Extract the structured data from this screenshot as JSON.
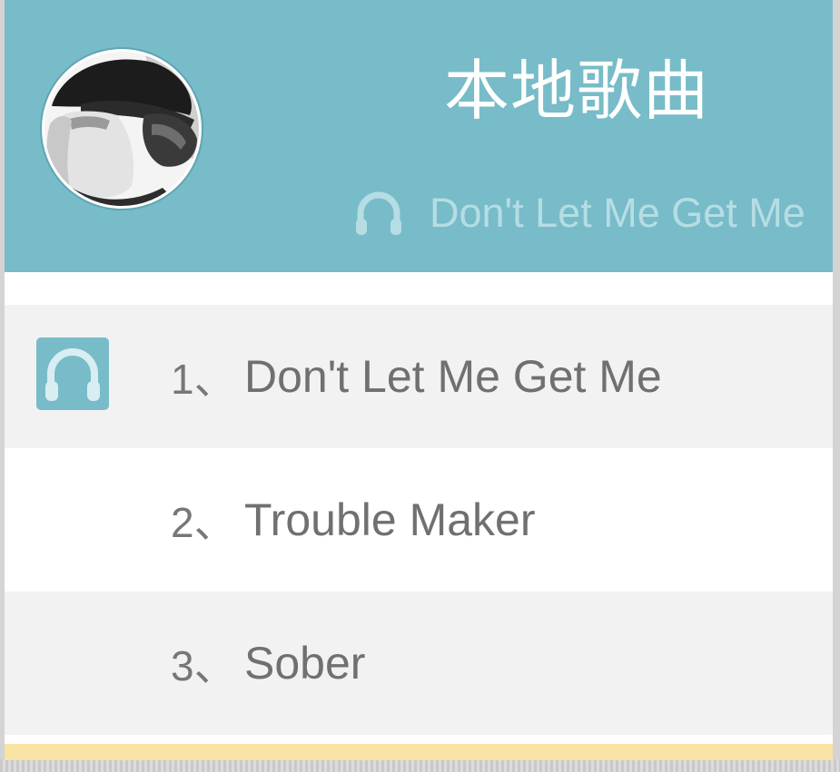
{
  "header": {
    "title": "本地歌曲",
    "now_playing": "Don't Let Me Get Me",
    "avatar_icon": "avatar",
    "headphone_icon": "headphones-icon"
  },
  "songs": [
    {
      "index": "1、",
      "title": "Don't Let Me Get Me",
      "playing": true
    },
    {
      "index": "2、",
      "title": "Trouble Maker",
      "playing": false
    },
    {
      "index": "3、",
      "title": "Sober",
      "playing": false
    }
  ],
  "colors": {
    "header_bg": "#77bcc8",
    "accent": "#77bcc8",
    "now_playing_text": "#b6dde4",
    "row_alt_bg": "#f2f2f2",
    "footer_bar": "#f8e4a5"
  }
}
